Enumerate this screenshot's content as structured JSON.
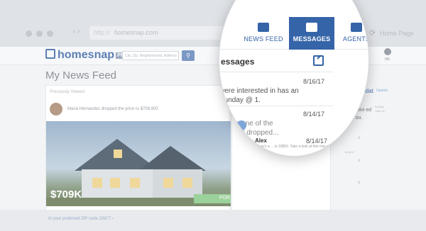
{
  "browser": {
    "url_protocol": "http://",
    "url": "homesnap.com",
    "nav_arrows": "‹ ›",
    "reload_icon": "refresh-icon",
    "tab_label": "Home Page"
  },
  "header": {
    "logo_text": "homesnap",
    "logo_badge": "PRO",
    "search_placeholder": "City, Zip, Neighborhood, Address",
    "search_button_icon": "search-icon",
    "me_label": "ME"
  },
  "feed": {
    "page_title": "My News Feed",
    "section_label": "Previously Viewed",
    "activity_text": "Maria Hernandez dropped the price to $708,900",
    "price": "$709K",
    "badge": "FOR",
    "zip_link": "In your preferred ZIP code 20877 ›"
  },
  "lens": {
    "tabs": [
      {
        "label": "NEWS FEED",
        "icon": "news-feed-icon"
      },
      {
        "label": "MESSAGES",
        "icon": "messages-icon"
      },
      {
        "label": "AGENTS",
        "icon": "agents-icon"
      }
    ],
    "messages_title": "essages",
    "compose_icon": "compose-icon",
    "messages": [
      {
        "date": "8/16/17",
        "line1": "were interested in has an",
        "line2": "Sunday @ 1."
      },
      {
        "date": "8/14/17",
        "line1": "red on one of the",
        "line2": "ested. It dropped..."
      },
      {
        "date": "8/14/17",
        "name": "Alex",
        "snippet": "There's a ... in 20850. Take a look at this one on Scare..."
      }
    ]
  },
  "right_col": {
    "heading": "Add/Updat",
    "heading_sub": "Update",
    "tiny1": "Activity",
    "tiny2": "Help us",
    "copy": "or market activi ed areas help ou.",
    "date_tiny": "8/14/17",
    "o_marks": [
      "o",
      "o",
      "o"
    ]
  },
  "colors": {
    "accent": "#3564a8",
    "badge_green": "#9bd19b",
    "link_blue": "#4a74b4"
  }
}
